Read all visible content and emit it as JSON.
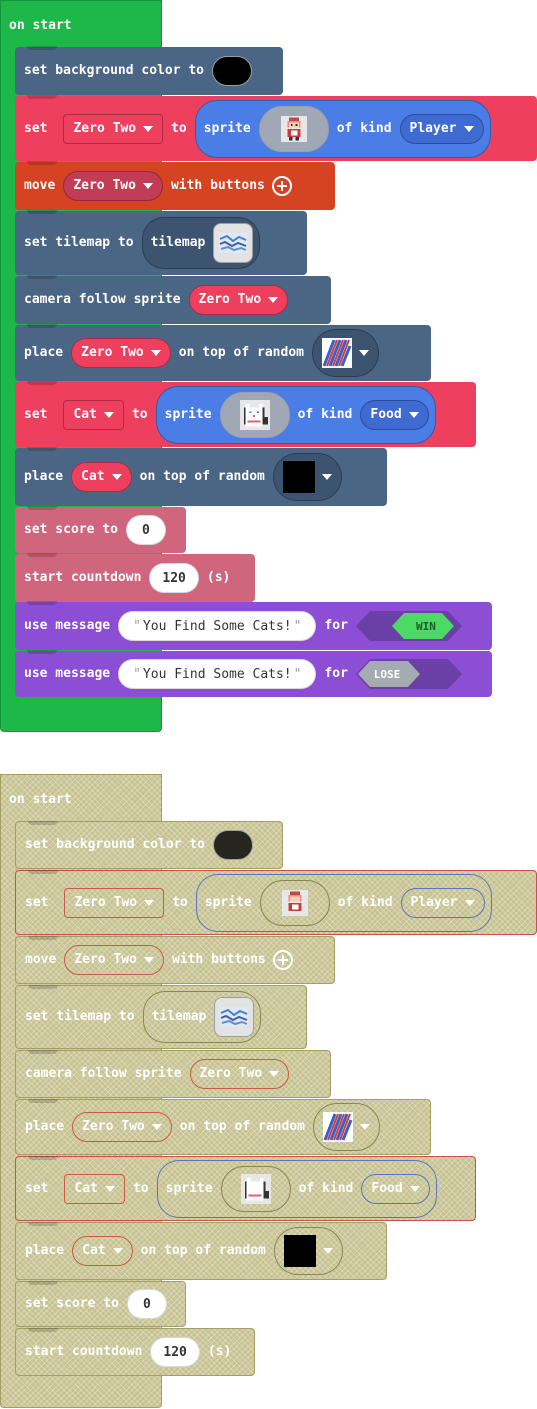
{
  "colors": {
    "events_green": "#1eb74a",
    "scene_slate": "#4b6584",
    "sprites_red": "#ef3f5e",
    "controller_orange": "#d54322",
    "info_pink": "#d0657e",
    "game_purple": "#8b4ed4",
    "disabled_olive": "#c6c291"
  },
  "top": {
    "hat_label": "on start",
    "bg_color": {
      "label": "set background color to",
      "value": "#000000"
    },
    "set_player": {
      "set": "set",
      "var": "Zero Two",
      "to": "to",
      "sprite": "sprite",
      "of_kind": "of kind",
      "kind": "Player",
      "icon": "zero-two-sprite-icon"
    },
    "move": {
      "label": "move",
      "var": "Zero Two",
      "suffix": "with buttons",
      "icon": "plus-icon"
    },
    "tilemap": {
      "label": "set tilemap to",
      "inner": "tilemap",
      "icon": "tilemap-thumbnail-icon"
    },
    "camera": {
      "label": "camera follow sprite",
      "var": "Zero Two"
    },
    "place_player": {
      "label": "place",
      "var": "Zero Two",
      "middle": "on top of random",
      "icon": "wall-tile-icon"
    },
    "set_cat": {
      "set": "set",
      "var": "Cat",
      "to": "to",
      "sprite": "sprite",
      "of_kind": "of kind",
      "kind": "Food",
      "icon": "cat-sprite-icon"
    },
    "place_cat": {
      "label": "place",
      "var": "Cat",
      "middle": "on top of random",
      "icon": "black-tile-icon"
    },
    "score": {
      "label": "set score to",
      "value": "0"
    },
    "countdown": {
      "label": "start countdown",
      "value": "120",
      "unit": "(s)"
    },
    "msg_win": {
      "label": "use message",
      "text": "You Find Some Cats!",
      "for": "for",
      "outcome": "WIN"
    },
    "msg_lose": {
      "label": "use message",
      "text": "You Find Some Cats!",
      "for": "for",
      "outcome": "LOSE"
    }
  },
  "bottom": {
    "hat_label": "on start",
    "bg_color": {
      "label": "set background color to",
      "value": "#26261e"
    },
    "set_player": {
      "set": "set",
      "var": "Zero Two",
      "to": "to",
      "sprite": "sprite",
      "of_kind": "of kind",
      "kind": "Player"
    },
    "move": {
      "label": "move",
      "var": "Zero Two",
      "suffix": "with buttons"
    },
    "tilemap": {
      "label": "set tilemap to",
      "inner": "tilemap"
    },
    "camera": {
      "label": "camera follow sprite",
      "var": "Zero Two"
    },
    "place_player": {
      "label": "place",
      "var": "Zero Two",
      "middle": "on top of random"
    },
    "set_cat": {
      "set": "set",
      "var": "Cat",
      "to": "to",
      "sprite": "sprite",
      "of_kind": "of kind",
      "kind": "Food"
    },
    "place_cat": {
      "label": "place",
      "var": "Cat",
      "middle": "on top of random"
    },
    "score": {
      "label": "set score to",
      "value": "0"
    },
    "countdown": {
      "label": "start countdown",
      "value": "120",
      "unit": "(s)"
    }
  }
}
